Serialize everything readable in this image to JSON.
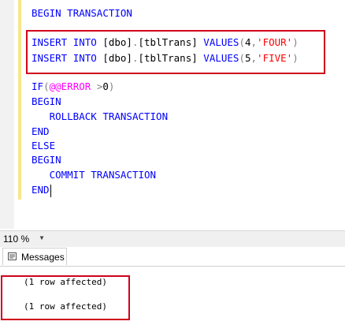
{
  "editor": {
    "lines": {
      "l1": {
        "begin": "BEGIN",
        "transaction": "TRANSACTION"
      },
      "l2": {
        "insert": "INSERT",
        "into": "INTO",
        "dbo": "[dbo]",
        "dot": ".",
        "table": "[tblTrans]",
        "values": "VALUES",
        "open": "(",
        "num": "4",
        "comma": ",",
        "str": "'FOUR'",
        "close": ")"
      },
      "l3": {
        "insert": "INSERT",
        "into": "INTO",
        "dbo": "[dbo]",
        "dot": ".",
        "table": "[tblTrans]",
        "values": "VALUES",
        "open": "(",
        "num": "5",
        "comma": ",",
        "str": "'FIVE'",
        "close": ")"
      },
      "l4": {
        "if": "IF",
        "open": "(",
        "error": "@@ERROR",
        "gt": ">",
        "zero": "0",
        "close": ")"
      },
      "l5": {
        "begin": "BEGIN"
      },
      "l6": {
        "rollback": "ROLLBACK",
        "transaction": "TRANSACTION"
      },
      "l7": {
        "end": "END"
      },
      "l8": {
        "else": "ELSE"
      },
      "l9": {
        "begin": "BEGIN"
      },
      "l10": {
        "commit": "COMMIT",
        "transaction": "TRANSACTION"
      },
      "l11": {
        "end": "END"
      }
    }
  },
  "status": {
    "zoom": "110 %"
  },
  "tabs": {
    "messages": "Messages"
  },
  "results": {
    "messages": [
      "(1 row affected)",
      "(1 row affected)"
    ]
  },
  "colors": {
    "keyword": "#0000ff",
    "system_function": "#ff00ff",
    "string": "#ff0000",
    "operator": "#808080",
    "highlight_box": "#d0021b"
  }
}
